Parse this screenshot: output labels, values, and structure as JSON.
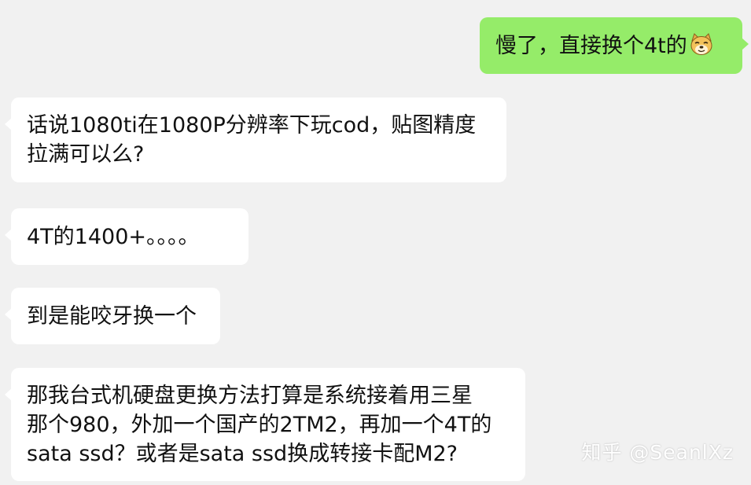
{
  "conversation": {
    "messages": [
      {
        "side": "right",
        "lines": [
          "慢了，直接换个4t的"
        ],
        "emoji": "doge-face-emoji"
      },
      {
        "side": "left",
        "lines": [
          "话说1080ti在1080P分辨率下玩cod，贴图精度",
          "拉满可以么?"
        ]
      },
      {
        "side": "left",
        "lines": [
          "4T的1400+。。。。"
        ]
      },
      {
        "side": "left",
        "lines": [
          "到是能咬牙换一个"
        ]
      },
      {
        "side": "left",
        "lines": [
          "那我台式机硬盘更换方法打算是系统接着用三星",
          "那个980，外加一个国产的2TM2，再加一个4T的",
          "sata ssd？或者是sata ssd换成转接卡配M2?"
        ]
      }
    ]
  },
  "watermark": {
    "text": "知乎 @SeanlXz"
  },
  "colors": {
    "background": "#f1f1f1",
    "incoming_bubble": "#ffffff",
    "outgoing_bubble": "#95ec69",
    "text": "#111111"
  }
}
